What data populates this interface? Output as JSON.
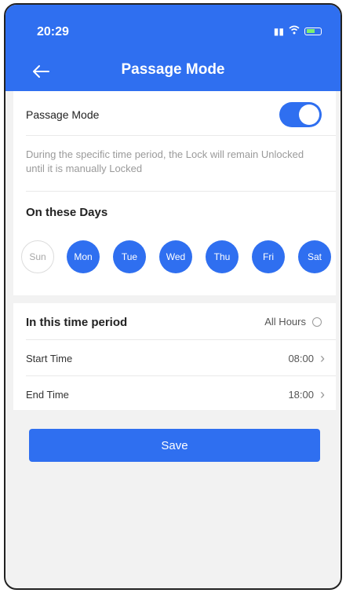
{
  "status_bar": {
    "time": "20:29"
  },
  "header": {
    "title": "Passage Mode",
    "back_icon": "back-arrow-icon"
  },
  "passage": {
    "label": "Passage Mode",
    "enabled": true,
    "description": "During the specific time period, the Lock will remain Unlocked until it is manually Locked"
  },
  "days": {
    "title": "On these Days",
    "items": [
      {
        "label": "Sun",
        "selected": false
      },
      {
        "label": "Mon",
        "selected": true
      },
      {
        "label": "Tue",
        "selected": true
      },
      {
        "label": "Wed",
        "selected": true
      },
      {
        "label": "Thu",
        "selected": true
      },
      {
        "label": "Fri",
        "selected": true
      },
      {
        "label": "Sat",
        "selected": true
      }
    ]
  },
  "time_period": {
    "title": "In this time period",
    "all_hours_label": "All Hours",
    "start_label": "Start Time",
    "start_value": "08:00",
    "end_label": "End Time",
    "end_value": "18:00"
  },
  "save_label": "Save",
  "colors": {
    "accent": "#2f6ff0",
    "background": "#f2f2f2"
  }
}
